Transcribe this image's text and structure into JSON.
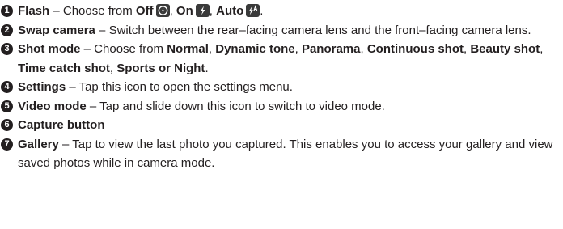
{
  "items": [
    {
      "number": "1",
      "title": "Flash",
      "sep": " – Choose from ",
      "off": "Off",
      "c1": ", ",
      "on": "On",
      "c2": ", ",
      "auto": "Auto",
      "end": "."
    },
    {
      "number": "2",
      "title": "Swap camera",
      "text": " – Switch between the rear–facing camera lens and the front–facing camera lens."
    },
    {
      "number": "3",
      "title": "Shot mode",
      "sep": " – Choose from ",
      "modes": [
        "Normal",
        "Dynamic tone",
        "Panorama",
        "Continuous shot",
        "Beauty shot",
        "Time catch shot",
        "Sports or Night"
      ],
      "comma": ", ",
      "end": "."
    },
    {
      "number": "4",
      "title": "Settings",
      "text": " – Tap this icon to open the settings menu."
    },
    {
      "number": "5",
      "title": "Video mode",
      "text": " –  Tap and slide down this icon to switch to video mode."
    },
    {
      "number": "6",
      "title": "Capture button"
    },
    {
      "number": "7",
      "title": "Gallery",
      "text": " – Tap to view the last photo you captured. This enables you to access your gallery and view saved photos while in camera mode."
    }
  ],
  "icons": {
    "flash_off": "flash-off-icon",
    "flash_on": "flash-on-icon",
    "flash_auto": "flash-auto-icon"
  }
}
